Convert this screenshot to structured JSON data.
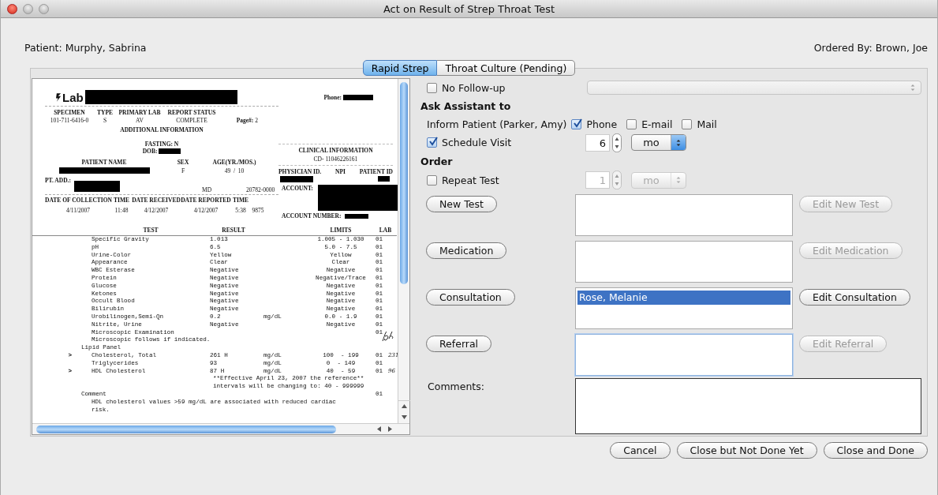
{
  "window": {
    "title": "Act on Result of Strep Throat Test"
  },
  "patient": "Patient: Murphy, Sabrina",
  "ordered_by": "Ordered By: Brown, Joe",
  "tabs": [
    {
      "label": "Rapid Strep",
      "selected": true
    },
    {
      "label": "Throat Culture (Pending)",
      "selected": false
    }
  ],
  "lab_report": {
    "logo": "Lab",
    "phone_label": "Phone:",
    "specimen_headers": [
      "SPECIMEN",
      "TYPE",
      "PRIMARY LAB",
      "REPORT STATUS"
    ],
    "specimen_values": [
      "101-711-6416-0",
      "S",
      "AV",
      "COMPLETE"
    ],
    "page_label": "Page#:",
    "page": "2",
    "additional_title": "ADDITIONAL INFORMATION",
    "fasting": "FASTING: N",
    "dob_label": "DOB:",
    "patient_headers": [
      "PATIENT NAME",
      "SEX",
      "AGE(YR./MOS.)"
    ],
    "sex": "F",
    "age": "49  /  10",
    "address_label": "PT. ADD.:",
    "state": "MD",
    "zip": "20782-0000",
    "date_headers": [
      "DATE OF COLLECTION",
      "TIME",
      "DATE RECEIVED",
      "DATE REPORTED",
      "TIME"
    ],
    "date_values": [
      "4/11/2007",
      "11:48",
      "4/12/2007",
      "4/12/2007",
      "5:38",
      "9875"
    ],
    "clinical_title": "CLINICAL INFORMATION",
    "clinical_code": "CD- 11046226161",
    "physician_headers": [
      "PHYSICIAN ID.",
      "NPI",
      "PATIENT ID"
    ],
    "account_label": "ACCOUNT:",
    "account_number_label": "ACCOUNT NUMBER:",
    "result_headers": [
      "TEST",
      "RESULT",
      "LIMITS",
      "LAB"
    ],
    "rows": [
      {
        "kind": "item",
        "test": "Specific Gravity",
        "result": "1.013",
        "limits": "1.005 - 1.030",
        "lab": "01"
      },
      {
        "kind": "item",
        "test": "pH",
        "result": "6.5",
        "limits": "5.0 - 7.5",
        "lab": "01"
      },
      {
        "kind": "item",
        "test": "Urine-Color",
        "result": "Yellow",
        "limits": "Yellow",
        "lab": "01"
      },
      {
        "kind": "item",
        "test": "Appearance",
        "result": "Clear",
        "limits": "Clear",
        "lab": "01"
      },
      {
        "kind": "item",
        "test": "WBC Esterase",
        "result": "Negative",
        "limits": "Negative",
        "lab": "01"
      },
      {
        "kind": "item",
        "test": "Protein",
        "result": "Negative",
        "limits": "Negative/Trace",
        "lab": "01"
      },
      {
        "kind": "item",
        "test": "Glucose",
        "result": "Negative",
        "limits": "Negative",
        "lab": "01"
      },
      {
        "kind": "item",
        "test": "Ketones",
        "result": "Negative",
        "limits": "Negative",
        "lab": "01"
      },
      {
        "kind": "item",
        "test": "Occult Blood",
        "result": "Negative",
        "limits": "Negative",
        "lab": "01"
      },
      {
        "kind": "item",
        "test": "Bilirubin",
        "result": "Negative",
        "limits": "Negative",
        "lab": "01"
      },
      {
        "kind": "item",
        "test": "Urobilinogen,Semi-Qn",
        "result": "0.2",
        "unit": "mg/dL",
        "limits": "0.0 - 1.9",
        "lab": "01"
      },
      {
        "kind": "item",
        "test": "Nitrite, Urine",
        "result": "Negative",
        "limits": "Negative",
        "lab": "01"
      },
      {
        "kind": "item",
        "test": "Microscopic Examination",
        "lab": "01"
      },
      {
        "kind": "item",
        "test": "Microscopic follows if indicated."
      },
      {
        "kind": "section",
        "test": "Lipid Panel"
      },
      {
        "kind": "item",
        "flag": ">",
        "test": "Cholesterol, Total",
        "result": "261 H",
        "unit": "mg/dL",
        "limits": "100  - 199",
        "lab": "01",
        "note": "231"
      },
      {
        "kind": "item",
        "test": "Triglycerides",
        "result": "93",
        "unit": "mg/dL",
        "limits": "0  - 149",
        "lab": "01"
      },
      {
        "kind": "item",
        "flag": ">",
        "test": "HDL Cholesterol",
        "result": "87 H",
        "unit": "mg/dL",
        "limits": "40  - 59",
        "lab": "01",
        "note": "96"
      },
      {
        "kind": "remark",
        "test": "**Effective April 23, 2007 the reference**"
      },
      {
        "kind": "remark",
        "test": "intervals will be changing to: 40 - 999999"
      },
      {
        "kind": "section",
        "test": "Comment",
        "lab": "01"
      },
      {
        "kind": "item",
        "test": "HDL cholesterol values >59 mg/dL are associated with reduced cardiac"
      },
      {
        "kind": "item",
        "test": "risk."
      }
    ]
  },
  "follow_up": {
    "label": "No Follow-up",
    "checked": false,
    "selector_disabled": true
  },
  "ask_assistant": {
    "title": "Ask Assistant to",
    "inform_label": "Inform Patient (Parker, Amy)",
    "contact_methods": [
      {
        "label": "Phone",
        "checked": true
      },
      {
        "label": "E-mail",
        "checked": false
      },
      {
        "label": "Mail",
        "checked": false
      }
    ],
    "schedule": {
      "label": "Schedule Visit",
      "checked": true,
      "amount": "6",
      "unit": "mo"
    }
  },
  "order": {
    "title": "Order",
    "repeat": {
      "label": "Repeat Test",
      "checked": false,
      "amount": "1",
      "unit": "mo"
    },
    "actions": [
      {
        "button": "New Test",
        "edit_button": "Edit New Test",
        "edit_enabled": false,
        "focused": false
      },
      {
        "button": "Medication",
        "edit_button": "Edit Medication",
        "edit_enabled": false,
        "focused": false
      },
      {
        "button": "Consultation",
        "items": [
          {
            "text": "Rose, Melanie",
            "selected": true
          }
        ],
        "edit_button": "Edit Consultation",
        "edit_enabled": true,
        "focused": false
      },
      {
        "button": "Referral",
        "edit_button": "Edit Referral",
        "edit_enabled": false,
        "focused": true
      }
    ]
  },
  "comments_label": "Comments:",
  "buttons": [
    {
      "label": "Cancel"
    },
    {
      "label": "Close but Not Done Yet"
    },
    {
      "label": "Close and Done"
    }
  ]
}
